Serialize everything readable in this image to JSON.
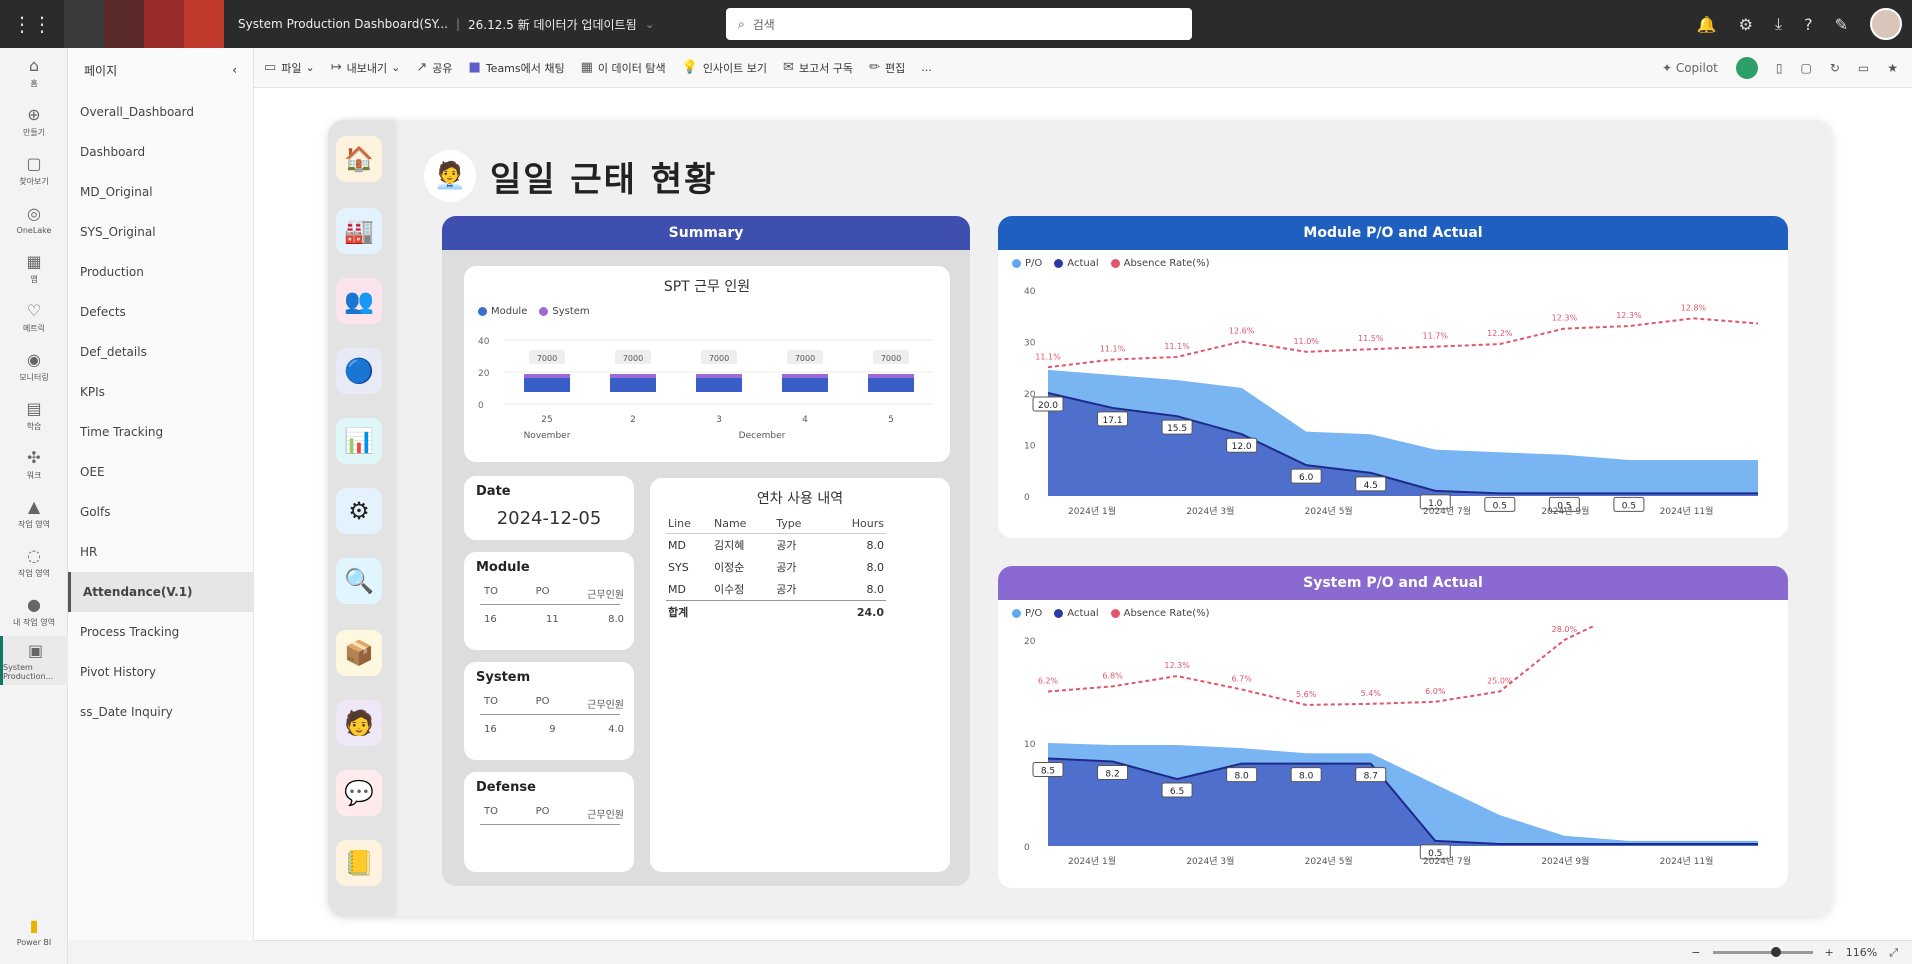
{
  "topbar": {
    "app_title": "System Production Dashboard(SY...",
    "breadcrumb": "26.12.5 新 데이터가 업데이트됨",
    "search_placeholder": "검색",
    "brand_colors": [
      "#3a3a3a",
      "#5a2a2a",
      "#9b2c2c",
      "#c0392b"
    ]
  },
  "leftrail": {
    "items": [
      {
        "label": "홈",
        "icon": "home-icon"
      },
      {
        "label": "만들기",
        "icon": "create-icon"
      },
      {
        "label": "찾아보기",
        "icon": "browse-icon"
      },
      {
        "label": "OneLake",
        "icon": "onelake-icon"
      },
      {
        "label": "앱",
        "icon": "apps-icon"
      },
      {
        "label": "메트릭",
        "icon": "metrics-icon"
      },
      {
        "label": "모니터링",
        "icon": "monitor-icon"
      },
      {
        "label": "학습",
        "icon": "learn-icon"
      },
      {
        "label": "워크",
        "icon": "workload-icon"
      },
      {
        "label": "작업 영역",
        "icon": "workspace-icon"
      },
      {
        "label": "작업 영역",
        "icon": "workspace2-icon"
      },
      {
        "label": "내 작업 영역",
        "icon": "my-workspace-icon"
      },
      {
        "label": "System Production...",
        "icon": "report-icon"
      }
    ],
    "bottom_label": "Power BI"
  },
  "pages": {
    "header": "페이지",
    "items": [
      "Overall_Dashboard",
      "Dashboard",
      "MD_Original",
      "SYS_Original",
      "Production",
      "Defects",
      "Def_details",
      "KPIs",
      "Time Tracking",
      "OEE",
      "Golfs",
      "HR",
      "Attendance(V.1)",
      "Process Tracking",
      "Pivot History",
      "ss_Date Inquiry"
    ],
    "active_index": 12
  },
  "toolbar": {
    "file": "파일",
    "export": "내보내기",
    "share": "공유",
    "teams": "Teams에서 채팅",
    "subscribe": "이 데이터 탐색",
    "insights": "인사이트 보기",
    "subscribe_report": "보고서 구독",
    "edit": "편집",
    "more": "...",
    "copilot": "Copilot"
  },
  "report": {
    "title": "일일 근태 현황",
    "nav_icons": [
      {
        "icon": "home-nav-icon",
        "glyph": "🏠"
      },
      {
        "icon": "factory-nav-icon",
        "glyph": "🏭"
      },
      {
        "icon": "people-nav-icon",
        "glyph": "👥"
      },
      {
        "icon": "gauge-nav-icon",
        "glyph": "🔵"
      },
      {
        "icon": "clipboard-nav-icon",
        "glyph": "📊"
      },
      {
        "icon": "gear-nav-icon",
        "glyph": "⚙"
      },
      {
        "icon": "search-nav-icon",
        "glyph": "🔍"
      },
      {
        "icon": "box-nav-icon",
        "glyph": "📦"
      },
      {
        "icon": "attendance-nav-icon",
        "glyph": "🧑"
      },
      {
        "icon": "chat-nav-icon",
        "glyph": "💬"
      },
      {
        "icon": "book-nav-icon",
        "glyph": "📒"
      }
    ],
    "summary": {
      "header": "Summary",
      "spt_title": "SPT 근무 인원",
      "legend": [
        "Module",
        "System"
      ],
      "yticks": [
        "40",
        "20",
        "0"
      ],
      "bar_labels": [
        "7000",
        "7000",
        "7000",
        "7000",
        "7000"
      ],
      "categories": [
        "25",
        "2",
        "3",
        "4",
        "5"
      ],
      "months": [
        "November",
        "December"
      ],
      "date_label": "Date",
      "date_value": "2024-12-05",
      "module_label": "Module",
      "module_cols": [
        "TO",
        "PO",
        "근무인원"
      ],
      "module_vals": [
        "16",
        "11",
        "8.0"
      ],
      "system_label": "System",
      "system_cols": [
        "TO",
        "PO",
        "근무인원"
      ],
      "system_vals": [
        "16",
        "9",
        "4.0"
      ],
      "defense_label": "Defense",
      "defense_cols": [
        "TO",
        "PO",
        "근무인원"
      ],
      "leave_title": "연차 사용 내역",
      "leave_cols": [
        "Line",
        "Name",
        "Type",
        "Hours"
      ],
      "leave_rows": [
        [
          "MD",
          "김지혜",
          "공가",
          "8.0"
        ],
        [
          "SYS",
          "이정순",
          "공가",
          "8.0"
        ],
        [
          "MD",
          "이수정",
          "공가",
          "8.0"
        ]
      ],
      "leave_total_label": "합계",
      "leave_total_value": "24.0"
    }
  },
  "chart_data": [
    {
      "type": "area",
      "title": "Module P/O and Actual",
      "legend": [
        "P/O",
        "Actual",
        "Absence Rate(%)"
      ],
      "colors": {
        "po": "#61a8f0",
        "actual": "#4a67c8",
        "absence": "#e0566a",
        "header": "#1f5fbf"
      },
      "yticks": [
        0,
        10,
        20,
        30,
        40
      ],
      "ylim": [
        0,
        40
      ],
      "x": [
        "2024년 1월",
        "2024년 3월",
        "2024년 5월",
        "2024년 7월",
        "2024년 9월",
        "2024년 11월"
      ],
      "po": [
        24.5,
        23.5,
        22.5,
        21.0,
        12.5,
        12.0,
        9.0,
        8.5,
        8.0,
        7.0,
        7.0,
        7.0
      ],
      "actual": [
        20.0,
        17.1,
        15.5,
        12.0,
        6.0,
        4.5,
        1.0,
        0.5,
        0.5,
        0.5,
        0.5,
        0.5
      ],
      "actual_labels": [
        "20.0",
        "17.1",
        "15.5",
        "12.0",
        "6.0",
        "4.5",
        "1.0",
        "0.5",
        "0.5",
        "0.5"
      ],
      "absence": [
        25.0,
        26.5,
        27.0,
        30.0,
        28.0,
        28.5,
        29.0,
        29.5,
        32.5,
        33.0,
        34.5,
        33.5
      ],
      "absence_labels": [
        "11.1%",
        "11.1%",
        "11.1%",
        "12.6%",
        "11.0%",
        "11.5%",
        "11.7%",
        "12.2%",
        "12.3%",
        "12.3%",
        "12.8%"
      ]
    },
    {
      "type": "area",
      "title": "System P/O and Actual",
      "legend": [
        "P/O",
        "Actual",
        "Absence Rate(%)"
      ],
      "colors": {
        "po": "#61a8f0",
        "actual": "#4a67c8",
        "absence": "#e0566a",
        "header": "#8a6ad0"
      },
      "yticks": [
        0,
        10,
        20
      ],
      "ylim": [
        0,
        20
      ],
      "x": [
        "2024년 1월",
        "2024년 3월",
        "2024년 5월",
        "2024년 7월",
        "2024년 9월",
        "2024년 11월"
      ],
      "po": [
        10.0,
        9.8,
        9.8,
        9.5,
        9.0,
        9.0,
        6.0,
        3.0,
        1.0,
        0.5,
        0.5,
        0.5
      ],
      "actual": [
        8.5,
        8.2,
        6.5,
        8.0,
        8.0,
        8.0,
        0.5,
        0.2,
        0.2,
        0.2,
        0.2,
        0.2
      ],
      "actual_labels": [
        "8.5",
        "8.2",
        "6.5",
        "8.0",
        "8.0",
        "8.7",
        "0.5"
      ],
      "absence": [
        15.0,
        15.5,
        16.5,
        15.2,
        13.7,
        13.8,
        14.0,
        15.0,
        20.0,
        23.0,
        24.0,
        24.5
      ],
      "absence_labels": [
        "6.2%",
        "6.8%",
        "12.3%",
        "6.7%",
        "5.6%",
        "5.4%",
        "6.0%",
        "25.0%",
        "28.0%"
      ]
    }
  ],
  "statusbar": {
    "zoom": "116%"
  }
}
